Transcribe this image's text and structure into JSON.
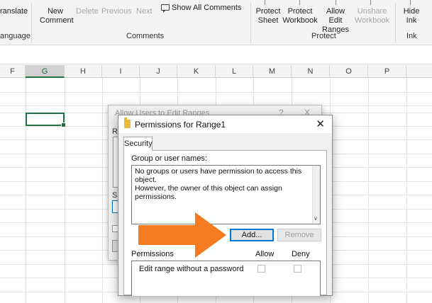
{
  "ribbon": {
    "translate": "ranslate",
    "language": "anguage",
    "new_comment_l1": "New",
    "new_comment_l2": "Comment",
    "delete": "Delete",
    "previous": "Previous",
    "next": "Next",
    "show_all_comments": "Show All Comments",
    "comments_group": "Comments",
    "protect_sheet_l1": "Protect",
    "protect_sheet_l2": "Sheet",
    "protect_workbook_l1": "Protect",
    "protect_workbook_l2": "Workbook",
    "allow_edit_l1": "Allow Edit",
    "allow_edit_l2": "Ranges",
    "unshare_l1": "Unshare",
    "unshare_l2": "Workbook",
    "protect_group": "Protect",
    "hide_ink_l1": "Hide",
    "hide_ink_l2": "Ink",
    "ink_group": "Ink"
  },
  "columns": [
    "F",
    "G",
    "H",
    "I",
    "J",
    "K",
    "L",
    "M",
    "N",
    "O",
    "P"
  ],
  "selected_column": "G",
  "bg_dialog": {
    "title": "Allow Users to Edit Ranges",
    "help": "?",
    "close": "X",
    "frag_r": "R",
    "frag_sp": "Sp"
  },
  "dialog": {
    "title": "Permissions for Range1",
    "close": "✕",
    "tab": "Security",
    "group_label": "Group or user names:",
    "message_l1": "No groups or users have permission to access this object.",
    "message_l2": "However, the owner of this object can assign permissions.",
    "add_button": "Add...",
    "remove_button": "Remove",
    "permissions_label": "Permissions",
    "allow_label": "Allow",
    "deny_label": "Deny",
    "permission_row": "Edit range without a password"
  },
  "colors": {
    "accent_green": "#217346",
    "arrow_orange": "#f47b20",
    "focus_blue": "#0078d7"
  }
}
